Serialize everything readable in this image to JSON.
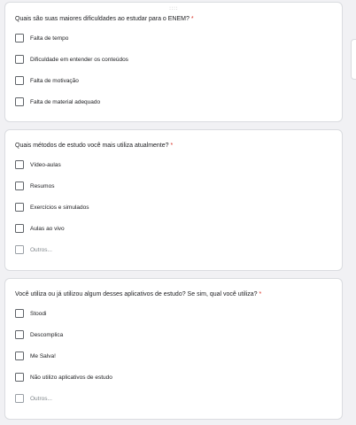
{
  "drag_handle": "::::",
  "questions": [
    {
      "title": "Quais são suas maiores dificuldades ao estudar para o ENEM?",
      "required_mark": "*",
      "options": [
        "Falta de tempo",
        "Dificuldade em entender os conteúdos",
        "Falta de motivação",
        "Falta de material adequado"
      ]
    },
    {
      "title": "Quais métodos de estudo você mais utiliza atualmente?",
      "required_mark": "*",
      "options": [
        "Vídeo-aulas",
        "Resumos",
        "Exercícios e simulados",
        "Aulas ao vivo"
      ],
      "other_label": "Outros..."
    },
    {
      "title": "Você utiliza ou já utilizou algum desses aplicativos de estudo? Se sim, qual você utiliza?",
      "required_mark": "*",
      "options": [
        "Stoodi",
        "Descomplica",
        "Me Salva!",
        "Não utilizo aplicativos de estudo"
      ],
      "other_label": "Outros..."
    }
  ],
  "colors": {
    "background": "#f1f1f4",
    "card": "#ffffff",
    "required": "#d93025",
    "border": "#dadce0"
  }
}
